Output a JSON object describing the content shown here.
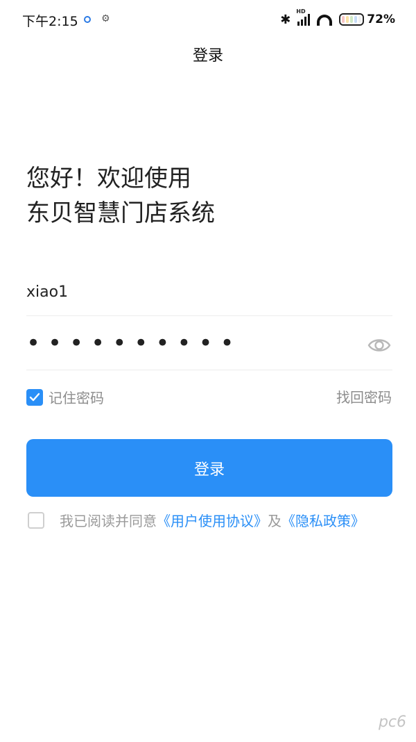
{
  "status_bar": {
    "time": "下午2:15",
    "battery": "72%",
    "network": "HD"
  },
  "header": {
    "title": "登录"
  },
  "welcome": {
    "line1": "您好！欢迎使用",
    "line2": "东贝智慧门店系统"
  },
  "form": {
    "username_value": "xiao1",
    "password_mask": "••••••••••"
  },
  "remember": {
    "label": "记住密码",
    "checked": true
  },
  "forgot_label": "找回密码",
  "login_button": "登录",
  "agreement": {
    "prefix": "我已阅读并同意",
    "user_agreement": "《用户使用协议》",
    "and": "及",
    "privacy_policy": "《隐私政策》"
  },
  "watermark": "pc6",
  "colors": {
    "accent": "#2a8ff7"
  },
  "icons": {
    "status_left": [
      "app-notification-icon",
      "settings-icon"
    ],
    "status_right": [
      "bluetooth-icon",
      "signal-icon",
      "wifi-icon",
      "battery-icon"
    ],
    "password_toggle": "eye-icon",
    "remember_checkbox": "check-icon"
  }
}
